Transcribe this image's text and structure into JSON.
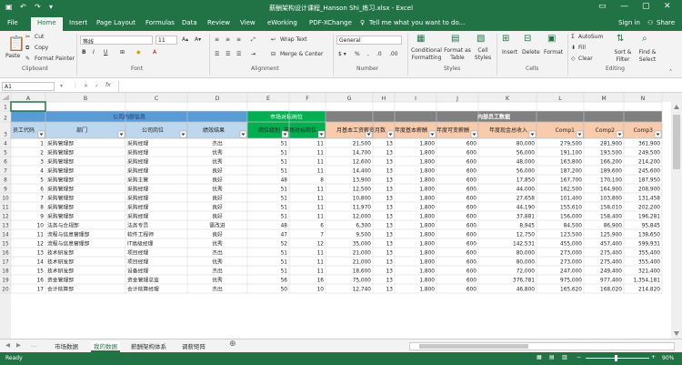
{
  "window": {
    "title": "薪酬架构设计课程_Hanson Shi_练习.xlsx - Excel",
    "signin": "Sign in",
    "share": "Share"
  },
  "tabs": [
    "File",
    "Home",
    "Insert",
    "Page Layout",
    "Formulas",
    "Data",
    "Review",
    "View",
    "eWorking",
    "PDF-XChange"
  ],
  "tell_me": "Tell me what you want to do...",
  "ribbon": {
    "paste": "Paste",
    "cut": "Cut",
    "copy": "Copy",
    "format_painter": "Format Painter",
    "clipboard": "Clipboard",
    "font_name": "等线",
    "font_size": "11",
    "font": "Font",
    "wrap_text": "Wrap Text",
    "merge_center": "Merge & Center",
    "alignment": "Alignment",
    "number_format": "General",
    "number": "Number",
    "conditional_formatting": "Conditional Formatting",
    "format_as_table": "Format as Table",
    "cell_styles": "Cell Styles",
    "styles": "Styles",
    "insert": "Insert",
    "delete": "Delete",
    "format": "Format",
    "cells": "Cells",
    "autosum": "AutoSum",
    "fill": "Fill",
    "clear": "Clear",
    "sort_filter": "Sort & Filter",
    "find_select": "Find & Select",
    "editing": "Editing"
  },
  "formula_bar": {
    "name_box": "A1"
  },
  "columns": [
    "A",
    "B",
    "C",
    "D",
    "E",
    "F",
    "G",
    "H",
    "I",
    "J",
    "K",
    "L",
    "M",
    "N"
  ],
  "row_numbers": [
    "1",
    "2",
    "3",
    "4",
    "5",
    "6",
    "7",
    "8",
    "9",
    "10",
    "11",
    "12",
    "13",
    "14",
    "15",
    "16",
    "17",
    "18",
    "19",
    "20"
  ],
  "group_headers": {
    "market": "公司内部信息",
    "grade": "市场对标岗位",
    "internal": "内部员工数据"
  },
  "headers": [
    "员工代码",
    "部门",
    "公司岗位",
    "绩效结果",
    "岗位级别",
    "市场对标岗位",
    "月基本工资",
    "薪资月数",
    "年度基本薪酬",
    "年度可变薪酬",
    "年度现金总收入",
    "Comp1",
    "Comp2",
    "Comp3"
  ],
  "rows": [
    [
      "1",
      "采购管理部",
      "采购经理",
      "杰出",
      "51",
      "11",
      "21,500",
      "13",
      "1,800",
      "600",
      "80,000",
      "279,500",
      "281,900",
      "361,900"
    ],
    [
      "2",
      "采购管理部",
      "采购经理",
      "优秀",
      "51",
      "11",
      "14,700",
      "13",
      "1,800",
      "600",
      "56,000",
      "191,100",
      "193,500",
      "249,500"
    ],
    [
      "3",
      "采购管理部",
      "采购经理",
      "优秀",
      "51",
      "11",
      "12,600",
      "13",
      "1,800",
      "600",
      "48,000",
      "163,800",
      "166,200",
      "214,200"
    ],
    [
      "4",
      "采购管理部",
      "采购经理",
      "良好",
      "51",
      "11",
      "14,400",
      "13",
      "1,800",
      "600",
      "56,000",
      "187,200",
      "189,600",
      "245,600"
    ],
    [
      "5",
      "采购管理部",
      "采购主管",
      "良好",
      "48",
      "8",
      "13,900",
      "13",
      "1,800",
      "600",
      "17,850",
      "167,700",
      "170,100",
      "187,950"
    ],
    [
      "6",
      "采购管理部",
      "采购经理",
      "优秀",
      "51",
      "11",
      "12,500",
      "13",
      "1,800",
      "600",
      "44,000",
      "162,500",
      "164,900",
      "208,900"
    ],
    [
      "7",
      "采购管理部",
      "采购经理",
      "良好",
      "51",
      "11",
      "10,800",
      "13",
      "1,800",
      "600",
      "27,658",
      "101,400",
      "103,800",
      "131,458"
    ],
    [
      "8",
      "采购管理部",
      "采购经理",
      "良好",
      "51",
      "11",
      "11,970",
      "13",
      "1,800",
      "600",
      "44,190",
      "155,610",
      "158,010",
      "202,200"
    ],
    [
      "9",
      "采购管理部",
      "采购经理",
      "良好",
      "51",
      "11",
      "12,000",
      "13",
      "1,800",
      "600",
      "37,881",
      "156,000",
      "158,400",
      "196,281"
    ],
    [
      "10",
      "法务与合规部",
      "法务专员",
      "需改进",
      "48",
      "6",
      "6,300",
      "13",
      "1,800",
      "600",
      "8,945",
      "84,500",
      "86,900",
      "95,845"
    ],
    [
      "11",
      "流程与信息管理部",
      "软件工程师",
      "良好",
      "47",
      "7",
      "9,500",
      "13",
      "1,800",
      "600",
      "12,750",
      "123,500",
      "125,900",
      "138,650"
    ],
    [
      "12",
      "流程与信息管理部",
      "IT高级经理",
      "优秀",
      "52",
      "12",
      "35,000",
      "13",
      "1,800",
      "600",
      "142,531",
      "455,000",
      "457,400",
      "599,931"
    ],
    [
      "13",
      "技术研发部",
      "项目经理",
      "杰出",
      "51",
      "11",
      "21,000",
      "13",
      "1,800",
      "600",
      "80,000",
      "273,000",
      "275,400",
      "355,400"
    ],
    [
      "14",
      "技术研发部",
      "项目经理",
      "优秀",
      "51",
      "11",
      "21,000",
      "13",
      "1,800",
      "600",
      "80,000",
      "273,000",
      "275,400",
      "355,400"
    ],
    [
      "15",
      "技术研发部",
      "设备经理",
      "杰出",
      "51",
      "11",
      "18,600",
      "13",
      "1,800",
      "600",
      "72,000",
      "247,000",
      "249,400",
      "321,400"
    ],
    [
      "16",
      "资金管理部",
      "资金管理总监",
      "优秀",
      "56",
      "16",
      "75,000",
      "13",
      "1,800",
      "600",
      "376,781",
      "975,000",
      "977,400",
      "1,354,181"
    ],
    [
      "17",
      "会计核算部",
      "会计核算经理",
      "杰出",
      "50",
      "10",
      "12,740",
      "13",
      "1,800",
      "600",
      "46,800",
      "165,620",
      "168,020",
      "214,820"
    ]
  ],
  "sheet_tabs": [
    "市场数据",
    "我的数据",
    "薪酬架构体系",
    "调薪矩阵"
  ],
  "active_sheet": "我的数据",
  "status": {
    "ready": "Ready",
    "zoom": "90%"
  },
  "colors": {
    "accent": "#217346",
    "group_blue": "#5b9bd5",
    "group_green": "#00b050",
    "group_gray": "#808080",
    "header_blue": "#bdd7ee",
    "header_green": "#00b050",
    "header_orange": "#f8cbad"
  }
}
